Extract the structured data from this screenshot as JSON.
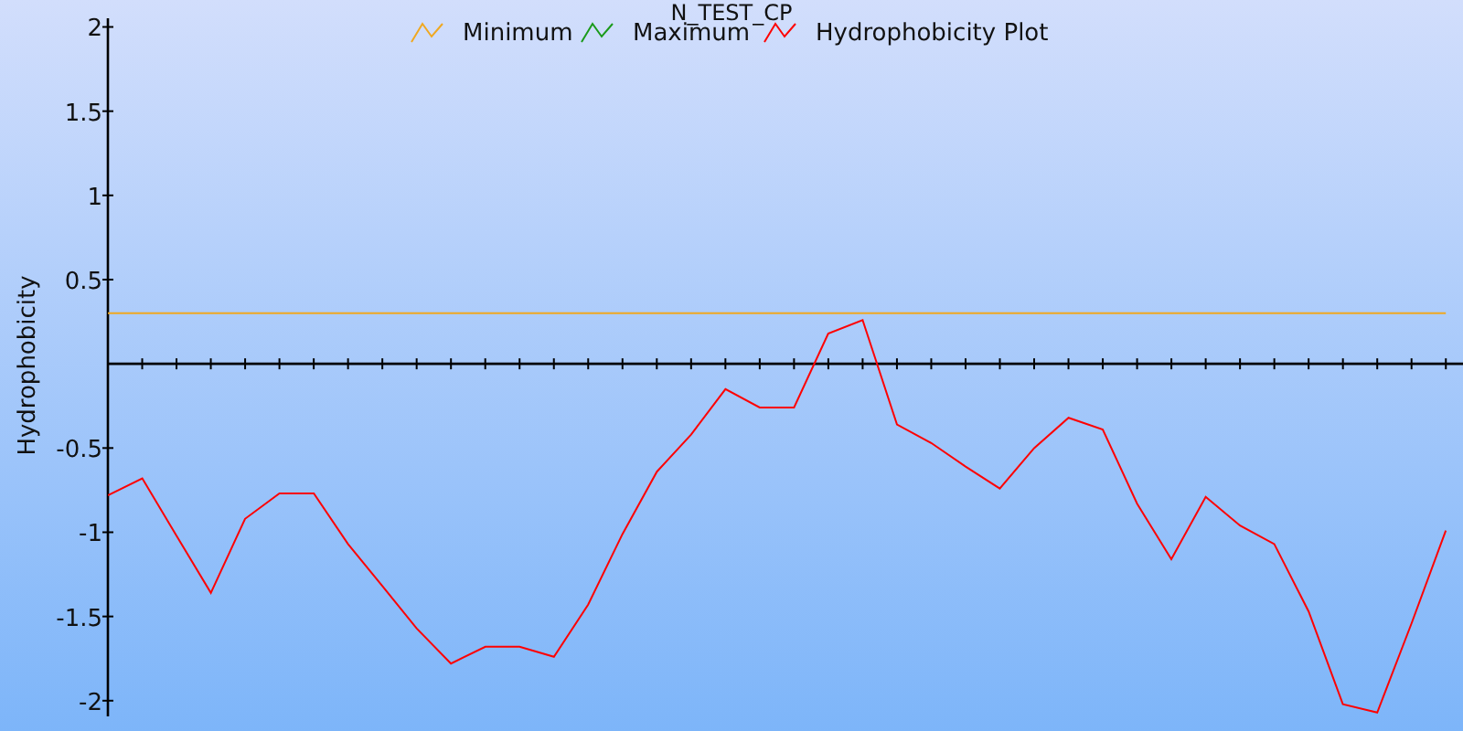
{
  "chart_data": {
    "type": "line",
    "legend": "top",
    "title": "N_TEST_CP",
    "ylabel": "Hydrophobicity",
    "categories": [
      null,
      null,
      null,
      null,
      null,
      null,
      null,
      null,
      null,
      null,
      null,
      null,
      null,
      null,
      null,
      null,
      null,
      null,
      null,
      null,
      null,
      null,
      null,
      null,
      null,
      null,
      null,
      null,
      null,
      null,
      null,
      null,
      null,
      null,
      null,
      null,
      null,
      null,
      null,
      null
    ],
    "ylim": [
      -2.18,
      2.16
    ],
    "yticks": [
      -2,
      -1.5,
      -1,
      -0.5,
      0.5,
      1,
      1.5,
      2
    ],
    "series": [
      {
        "name": "Minimum",
        "color": "#f0a820",
        "values": [
          0.3,
          0.3,
          0.3,
          0.3,
          0.3,
          0.3,
          0.3,
          0.3,
          0.3,
          0.3,
          0.3,
          0.3,
          0.3,
          0.3,
          0.3,
          0.3,
          0.3,
          0.3,
          0.3,
          0.3,
          0.3,
          0.3,
          0.3,
          0.3,
          0.3,
          0.3,
          0.3,
          0.3,
          0.3,
          0.3,
          0.3,
          0.3,
          0.3,
          0.3,
          0.3,
          0.3,
          0.3,
          0.3,
          0.3,
          0.3
        ]
      },
      {
        "name": "Maximum",
        "color": "#1a9a1a",
        "values": [
          null,
          null,
          null,
          null,
          null,
          null,
          null,
          null,
          null,
          null,
          null,
          null,
          null,
          null,
          null,
          null,
          null,
          null,
          null,
          null,
          null,
          null,
          null,
          null,
          null,
          null,
          null,
          null,
          null,
          null,
          null,
          null,
          null,
          null,
          null,
          null,
          null,
          null,
          null,
          null
        ]
      },
      {
        "name": "Hydrophobicity Plot",
        "color": "#ff0000",
        "values": [
          -0.78,
          -0.68,
          -1.02,
          -1.36,
          -0.92,
          -0.77,
          -0.77,
          -1.07,
          -1.32,
          -1.57,
          -1.78,
          -1.68,
          -1.68,
          -1.74,
          -1.43,
          -1.01,
          -0.64,
          -0.42,
          -0.15,
          -0.26,
          -0.26,
          0.18,
          0.26,
          -0.36,
          -0.47,
          -0.61,
          -0.74,
          -0.5,
          -0.32,
          -0.39,
          -0.83,
          -1.16,
          -0.79,
          -0.96,
          -1.07,
          -1.47,
          -2.02,
          -2.07,
          -1.54,
          -0.99
        ]
      }
    ]
  }
}
